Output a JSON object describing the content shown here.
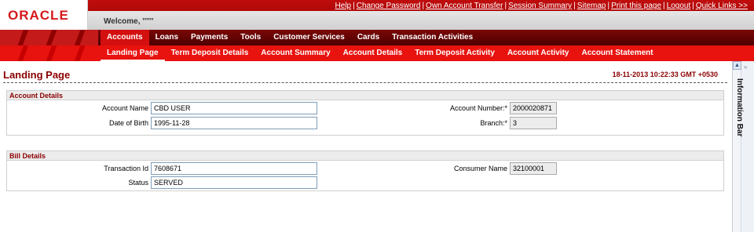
{
  "header": {
    "logo_text": "ORACLE",
    "welcome": "Welcome, ''''''",
    "links": [
      "Help",
      "Change Password",
      "Own Account Transfer",
      "Session Summary",
      "Sitemap",
      "Print this page",
      "Logout",
      "Quick Links >>"
    ]
  },
  "main_menu": {
    "items": [
      "Accounts",
      "Loans",
      "Payments",
      "Tools",
      "Customer Services",
      "Cards",
      "Transaction Activities"
    ]
  },
  "sub_menu": {
    "items": [
      "Landing Page",
      "Term Deposit Details",
      "Account Summary",
      "Account Details",
      "Term Deposit Activity",
      "Account Activity",
      "Account Statement"
    ]
  },
  "page": {
    "title": "Landing Page",
    "timestamp": "18-11-2013 10:22:33 GMT +0530"
  },
  "account_details": {
    "heading": "Account Details",
    "account_name_label": "Account Name",
    "account_name_value": "CBD USER",
    "dob_label": "Date of Birth",
    "dob_value": "1995-11-28",
    "account_number_label": "Account Number:*",
    "account_number_value": "2000020871",
    "branch_label": "Branch:*",
    "branch_value": "3"
  },
  "bill_details": {
    "heading": "Bill Details",
    "transaction_id_label": "Transaction Id",
    "transaction_id_value": "7608671",
    "status_label": "Status",
    "status_value": "SERVED",
    "consumer_name_label": "Consumer Name",
    "consumer_name_value": "32100001"
  },
  "info_bar": {
    "label": "Information Bar"
  },
  "colors": {
    "brand_red": "#d4191c",
    "menu_dark": "#5a0000",
    "submenu_red": "#e8120f",
    "title_red": "#8b0000"
  }
}
